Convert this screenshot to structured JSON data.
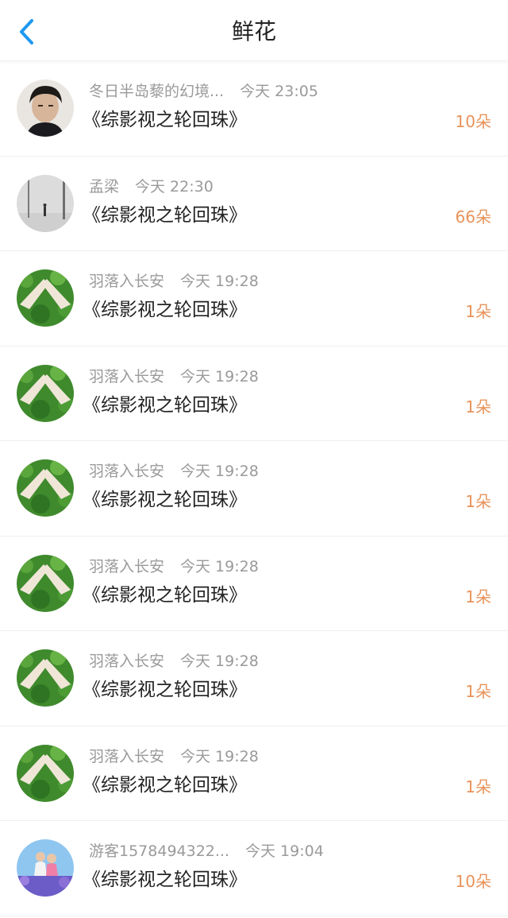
{
  "header": {
    "title": "鲜花",
    "back_icon": "chevron-left-icon",
    "accent_color": "#1f98f0"
  },
  "list": {
    "items": [
      {
        "name": "冬日半岛藜的幻境...",
        "time": "今天 23:05",
        "book": "《综影视之轮回珠》",
        "count": "10朵",
        "avatar": "person-portrait"
      },
      {
        "name": "孟梁",
        "time": "今天 22:30",
        "book": "《综影视之轮回珠》",
        "count": "66朵",
        "avatar": "misty-landscape"
      },
      {
        "name": "羽落入长安",
        "time": "今天 19:28",
        "book": "《综影视之轮回珠》",
        "count": "1朵",
        "avatar": "hand-heart-plants"
      },
      {
        "name": "羽落入长安",
        "time": "今天 19:28",
        "book": "《综影视之轮回珠》",
        "count": "1朵",
        "avatar": "hand-heart-plants"
      },
      {
        "name": "羽落入长安",
        "time": "今天 19:28",
        "book": "《综影视之轮回珠》",
        "count": "1朵",
        "avatar": "hand-heart-plants"
      },
      {
        "name": "羽落入长安",
        "time": "今天 19:28",
        "book": "《综影视之轮回珠》",
        "count": "1朵",
        "avatar": "hand-heart-plants"
      },
      {
        "name": "羽落入长安",
        "time": "今天 19:28",
        "book": "《综影视之轮回珠》",
        "count": "1朵",
        "avatar": "hand-heart-plants"
      },
      {
        "name": "羽落入长安",
        "time": "今天 19:28",
        "book": "《综影视之轮回珠》",
        "count": "1朵",
        "avatar": "hand-heart-plants"
      },
      {
        "name": "游客1578494322...",
        "time": "今天 19:04",
        "book": "《综影视之轮回珠》",
        "count": "10朵",
        "avatar": "couple-flowers"
      }
    ]
  },
  "colors": {
    "count": "#e8935a",
    "meta": "#9a9a9a",
    "divider": "#efefef"
  }
}
